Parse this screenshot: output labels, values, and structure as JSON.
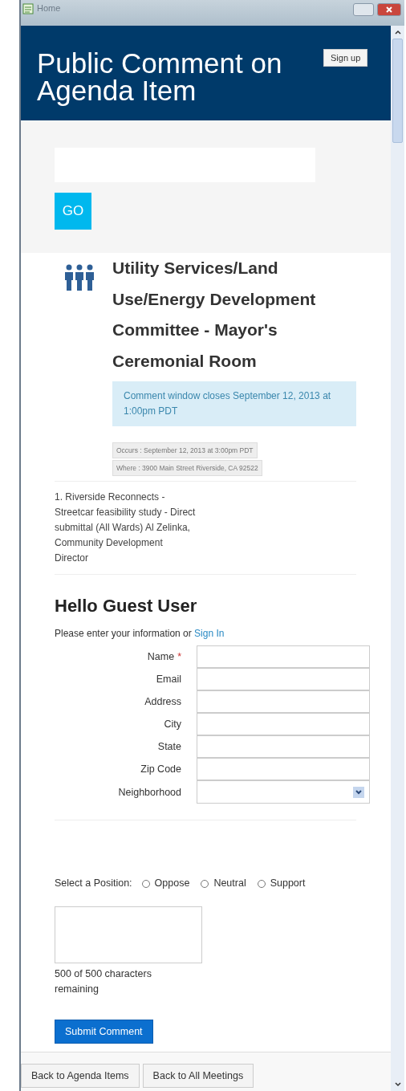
{
  "window": {
    "title": "Home"
  },
  "header": {
    "title": "Public Comment on Agenda Item",
    "sign_up": "Sign up"
  },
  "search": {
    "button": "GO"
  },
  "meeting": {
    "title": "Utility Services/Land Use/Energy Development Committee - Mayor's Ceremonial Room",
    "notice": "Comment window closes September 12, 2013 at 1:00pm PDT",
    "details": [
      "Occurs : September 12, 2013 at 3:00pm PDT",
      "Where : 3900 Main Street Riverside, CA 92522"
    ]
  },
  "agenda_item": "1. Riverside Reconnects - Streetcar feasibility study - Direct submittal (All Wards) Al Zelinka, Community Development Director",
  "form": {
    "heading": "Hello Guest User",
    "intro": "Please enter your information or",
    "sign_in": "Sign In",
    "fields": [
      {
        "label": "Name",
        "kind": "text",
        "required_mark": "*"
      },
      {
        "label": "Email",
        "kind": "text"
      },
      {
        "label": "Address",
        "kind": "text"
      },
      {
        "label": "City",
        "kind": "text"
      },
      {
        "label": "State",
        "kind": "text"
      },
      {
        "label": "Zip Code",
        "kind": "text"
      },
      {
        "label": "Neighborhood",
        "kind": "select"
      }
    ],
    "position_label": "Select a Position:",
    "positions": [
      {
        "label": "Oppose",
        "selected": false
      },
      {
        "label": "Neutral",
        "selected": false
      },
      {
        "label": "Support",
        "selected": false
      }
    ],
    "counter": "500 of 500 characters remaining",
    "submit": "Submit Comment"
  },
  "footer": {
    "buttons": [
      "Back to Agenda Items",
      "Back to All Meetings"
    ]
  }
}
